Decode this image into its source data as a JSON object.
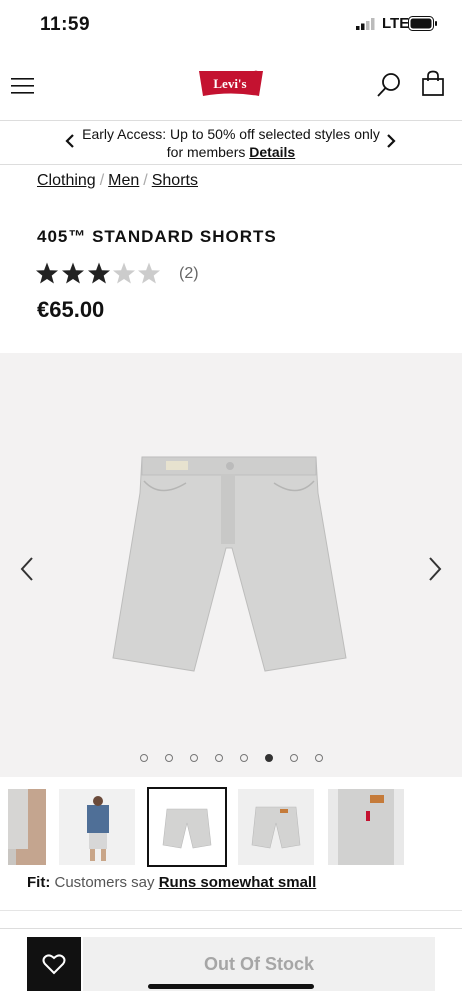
{
  "status_bar": {
    "time": "11:59",
    "network": "LTE"
  },
  "header": {
    "logo_text": "Levi's",
    "menu_icon": "hamburger-icon",
    "search_icon": "search-icon",
    "bag_icon": "shopping-bag-icon",
    "brand_color": "#c41230"
  },
  "promo": {
    "text": "Early Access: Up to 50% off selected styles only for members",
    "link": "Details"
  },
  "breadcrumb": [
    "Clothing",
    "Men",
    "Shorts"
  ],
  "product": {
    "title": "405™ STANDARD SHORTS",
    "rating": 3.5,
    "rating_max": 5,
    "review_count": "(2)",
    "price": "€65.00"
  },
  "gallery": {
    "dot_count": 8,
    "active_dot": 5
  },
  "fit": {
    "label": "Fit:",
    "prefix": "Customers say",
    "value": "Runs somewhat small"
  },
  "actions": {
    "out_of_stock": "Out Of Stock",
    "wishlist_icon": "heart-icon"
  }
}
